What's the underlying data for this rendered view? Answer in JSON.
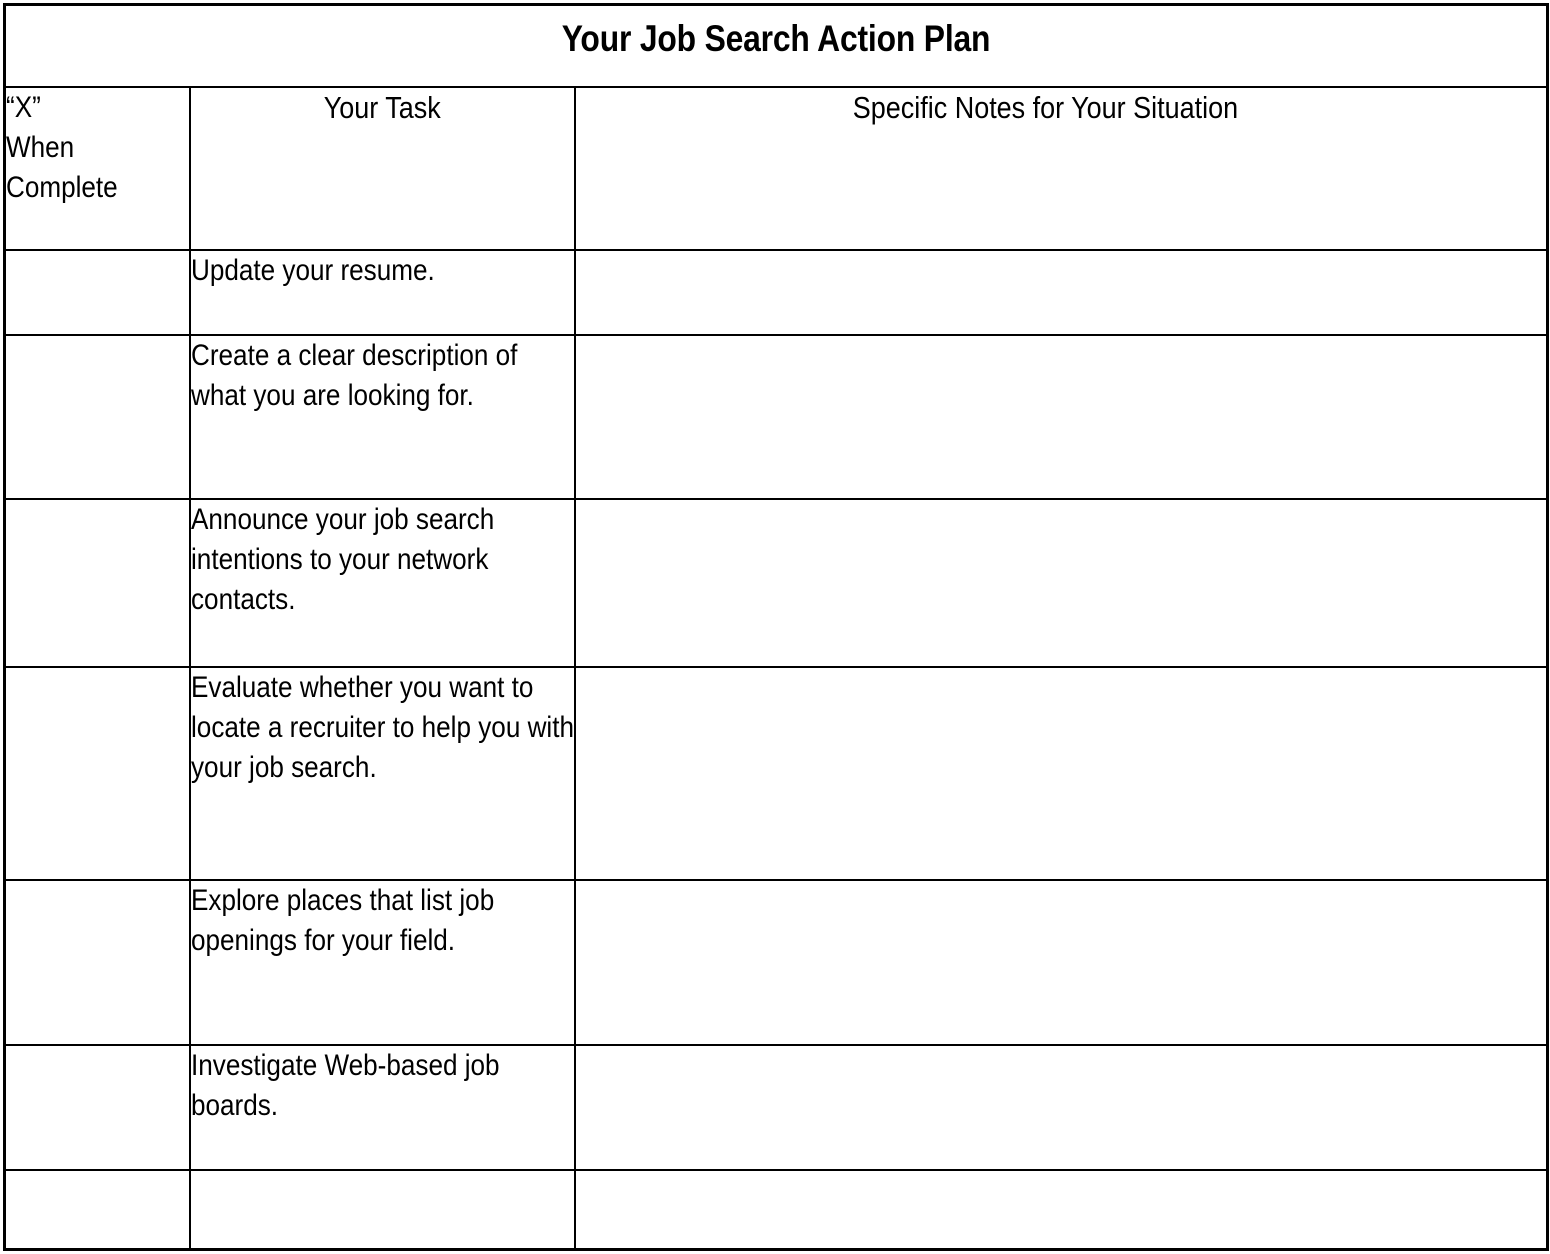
{
  "document": {
    "title": "Your Job Search Action Plan",
    "type": "worksheet-table",
    "background_color": "#ffffff",
    "text_color": "#000000",
    "border_color": "#000000"
  },
  "table": {
    "headers": {
      "check_column": {
        "line1": "“X”",
        "line2": "When",
        "line3": "Complete"
      },
      "task_column": "Your Task",
      "notes_column": "Specific Notes for Your Situation"
    },
    "rows": [
      {
        "check": "",
        "task": "Update your resume.",
        "notes": ""
      },
      {
        "check": "",
        "task": "Create a clear description of what you are looking for.",
        "notes": ""
      },
      {
        "check": "",
        "task": "Announce your job search intentions to your network contacts.",
        "notes": ""
      },
      {
        "check": "",
        "task": "Evaluate whether you want to locate a recruiter to help you with your job search.",
        "notes": ""
      },
      {
        "check": "",
        "task": "Explore places that list job openings for your field.",
        "notes": ""
      },
      {
        "check": "",
        "task": "Investigate Web-based job boards.",
        "notes": ""
      },
      {
        "check": "",
        "task": "",
        "notes": ""
      }
    ]
  }
}
